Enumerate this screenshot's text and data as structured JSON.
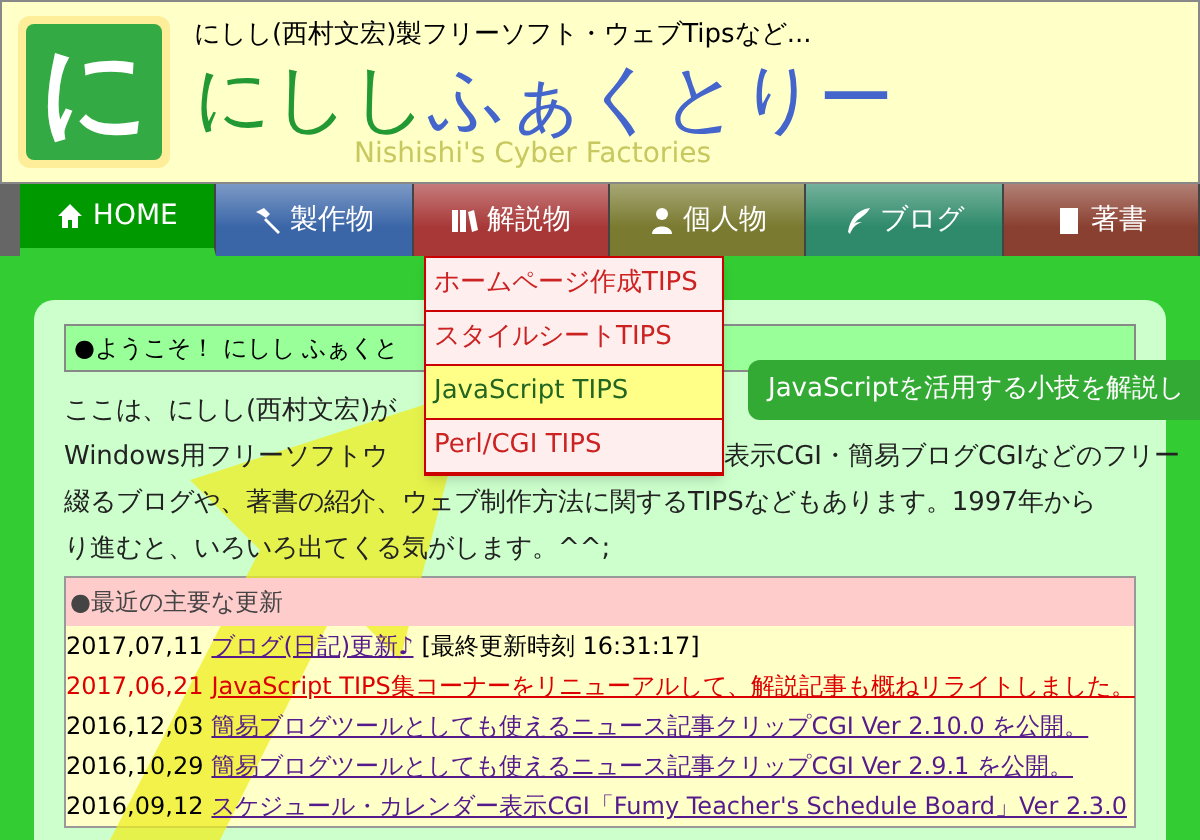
{
  "header": {
    "logo_glyph": "に",
    "tagline": "にしし(西村文宏)製フリーソフト・ウェブTipsなど...",
    "title_green": "にしし",
    "title_blue": "ふぁくとりー",
    "subtitle": "Nishishi's Cyber Factories"
  },
  "nav": [
    {
      "label": "HOME",
      "selected": true,
      "color": "#009900"
    },
    {
      "label": "製作物",
      "selected": false,
      "color": "#3a66a8"
    },
    {
      "label": "解説物",
      "selected": false,
      "color": "#a83838"
    },
    {
      "label": "個人物",
      "selected": false,
      "color": "#7a7a30"
    },
    {
      "label": "ブログ",
      "selected": false,
      "color": "#2e8a6a"
    },
    {
      "label": "著書",
      "selected": false,
      "color": "#8a4030"
    }
  ],
  "dropdown": {
    "items": [
      {
        "label": "ホームページ作成TIPS",
        "selected": false
      },
      {
        "label": "スタイルシートTIPS",
        "selected": false
      },
      {
        "label": "JavaScript TIPS",
        "selected": true
      },
      {
        "label": "Perl/CGI TIPS",
        "selected": false
      }
    ]
  },
  "tooltip": "JavaScriptを活用する小技を解説し",
  "welcome": {
    "heading": "●ようこそ！ にしし ふぁくと",
    "lines": [
      {
        "segments": [
          "ここは、にしし(西村文宏)が"
        ]
      },
      {
        "segments": [
          "Windows用フリーソフトウ",
          "表示CGI・簡易ブログCGIなどのフリー"
        ]
      },
      {
        "segments": [
          "綴るブログや、著書の紹介、ウェブ制作方法に関するTIPSなどもあります。1997年から"
        ]
      },
      {
        "segments": [
          "り進むと、いろいろ出てくる気がします。^^;"
        ]
      }
    ]
  },
  "updates": {
    "heading": "●最近の主要な更新",
    "items": [
      {
        "date": "2017,07,11",
        "text": "ブログ(日記)更新♪",
        "note": "[最終更新時刻 16:31:17]",
        "highlight": false
      },
      {
        "date": "2017,06,21",
        "text": "JavaScript TIPS集コーナーをリニューアルして、解説記事も概ねリライトしました。",
        "highlight": true
      },
      {
        "date": "2016,12,03",
        "text": "簡易ブログツールとしても使えるニュース記事クリップCGI Ver 2.10.0 を公開。",
        "highlight": false
      },
      {
        "date": "2016,10,29",
        "text": "簡易ブログツールとしても使えるニュース記事クリップCGI Ver 2.9.1 を公開。",
        "highlight": false
      },
      {
        "date": "2016,09,12",
        "text": "スケジュール・カレンダー表示CGI「Fumy Teacher's Schedule Board」Ver 2.3.0",
        "highlight": false
      }
    ]
  }
}
